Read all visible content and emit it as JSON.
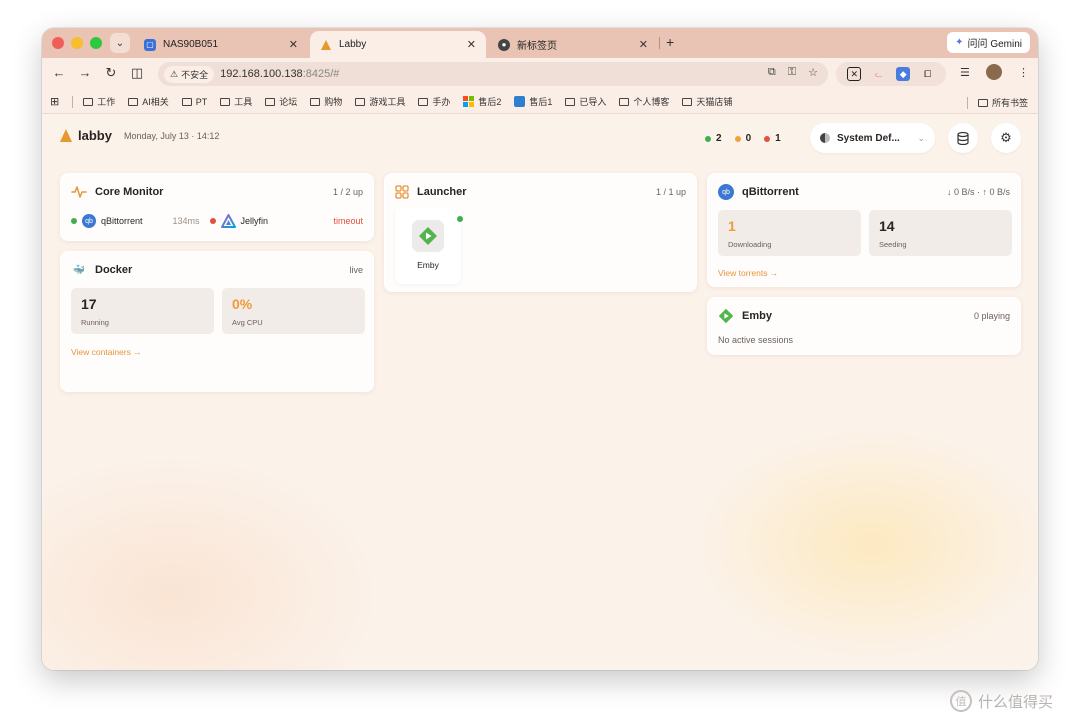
{
  "browser": {
    "tabs": [
      {
        "title": "NAS90B051",
        "favicon_color": "#3b6fd9"
      },
      {
        "title": "Labby",
        "favicon_color": "#e49a2c"
      },
      {
        "title": "新标签页",
        "favicon_color": "#444444"
      }
    ],
    "gemini_label": "问问 Gemini",
    "security_label": "不安全",
    "url_host": "192.168.100.138",
    "url_rest": ":8425/#",
    "bookmarks": [
      "工作",
      "AI相关",
      "PT",
      "工具",
      "论坛",
      "购物",
      "游戏工具",
      "手办",
      "售后2",
      "售后1",
      "已导入",
      "个人博客",
      "天猫店铺"
    ],
    "all_bookmarks_label": "所有书签"
  },
  "header": {
    "brand": "labby",
    "date": "Monday, July 13 · 14:12",
    "stats": [
      {
        "value": "2",
        "color": "#3fae4f"
      },
      {
        "value": "0",
        "color": "#f0a33a"
      },
      {
        "value": "1",
        "color": "#e2513f"
      }
    ],
    "theme_label": "System Def...",
    "icons": {
      "theme": "theme-icon",
      "database": "database-icon",
      "settings": "gear-icon"
    }
  },
  "core_monitor": {
    "title": "Core Monitor",
    "meta": "1 / 2 up",
    "items": [
      {
        "name": "qBittorrent",
        "latency": "134ms",
        "status_color": "#3fae4f"
      },
      {
        "name": "Jellyfin",
        "status": "timeout",
        "status_color": "#e2513f"
      }
    ]
  },
  "docker": {
    "title": "Docker",
    "meta": "live",
    "running_value": "17",
    "running_label": "Running",
    "cpu_value": "0%",
    "cpu_label": "Avg CPU",
    "link": "View containers →"
  },
  "launcher": {
    "title": "Launcher",
    "meta": "1 / 1 up",
    "apps": [
      {
        "name": "Emby"
      }
    ]
  },
  "qbittorrent": {
    "title": "qBittorrent",
    "meta": "↓ 0 B/s · ↑ 0 B/s",
    "downloading_value": "1",
    "downloading_label": "Downloading",
    "seeding_value": "14",
    "seeding_label": "Seeding",
    "link": "View torrents →"
  },
  "emby": {
    "title": "Emby",
    "meta": "0 playing",
    "status": "No active sessions"
  },
  "watermark": "什么值得买"
}
